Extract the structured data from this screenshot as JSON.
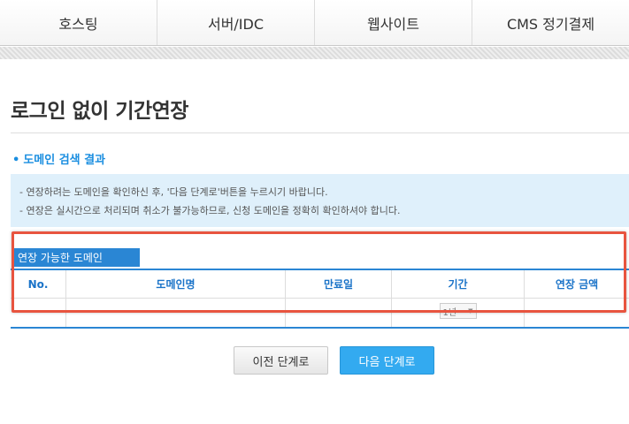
{
  "nav": {
    "items": [
      {
        "label": "호스팅"
      },
      {
        "label": "서버/IDC"
      },
      {
        "label": "웹사이트"
      },
      {
        "label": "CMS 정기결제"
      }
    ]
  },
  "page": {
    "title": "로그인 없이 기간연장"
  },
  "section": {
    "bullet": "•",
    "heading": "도메인 검색 결과"
  },
  "notice": {
    "lines": [
      "- 연장하려는 도메인을 확인하신 후, '다음 단계로'버튼을 누르시기 바랍니다.",
      "- 연장은 실시간으로 처리되며 취소가 불가능하므로, 신청 도메인을 정확히 확인하셔야 합니다."
    ]
  },
  "table": {
    "caption": "연장 가능한 도메인",
    "columns": [
      "No.",
      "도메인명",
      "만료일",
      "기간",
      "연장 금액"
    ],
    "period_select": {
      "value": "1년",
      "icon": "chevron-down-icon"
    }
  },
  "buttons": {
    "prev": "이전 단계로",
    "next": "다음 단계로"
  },
  "colors": {
    "accent": "#1a8ee0",
    "table_border": "#2a86d4",
    "highlight": "#e8543f",
    "notice_bg": "#dff0fb",
    "next_button": "#33aaf0"
  }
}
